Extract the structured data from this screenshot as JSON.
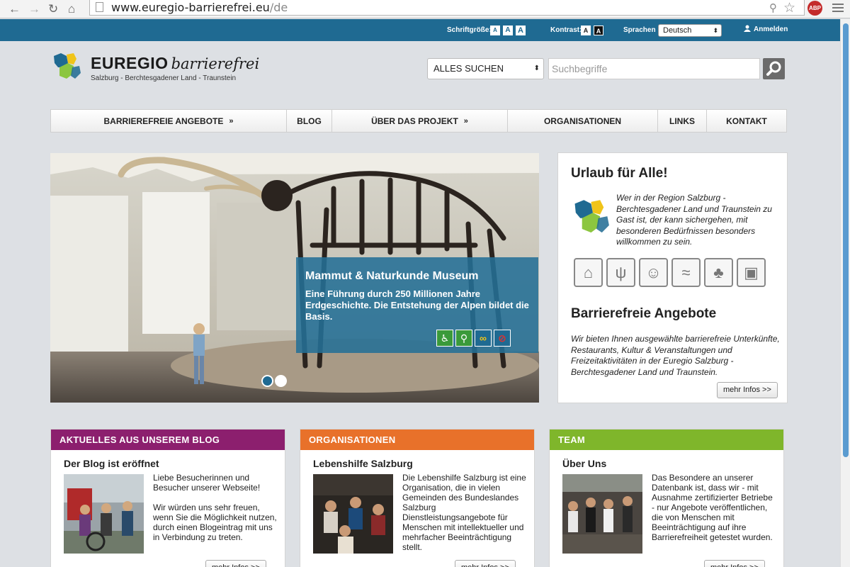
{
  "browser": {
    "url_host": "www.euregio-barrierefrei.eu",
    "url_path": "/de",
    "adblock_label": "ABP"
  },
  "topbar": {
    "font_size_label": "Schriftgröße:",
    "font_size_buttons": [
      "A",
      "A",
      "A"
    ],
    "contrast_label": "Kontrast:",
    "contrast_buttons": [
      "A",
      "A"
    ],
    "language_label": "Sprachen",
    "language_value": "Deutsch",
    "login_label": "Anmelden"
  },
  "logo": {
    "title_bold": "EUREGIO",
    "title_italic": "barrierefrei",
    "subtitle": "Salzburg - Berchtesgadener Land - Traunstein"
  },
  "search": {
    "category_value": "ALLES SUCHEN",
    "placeholder": "Suchbegriffe"
  },
  "nav": {
    "items": [
      {
        "label": "BARRIEREFREIE ANGEBOTE",
        "has_submenu": true
      },
      {
        "label": "BLOG",
        "has_submenu": false
      },
      {
        "label": "ÜBER DAS PROJEKT",
        "has_submenu": true
      },
      {
        "label": "ORGANISATIONEN",
        "has_submenu": false
      },
      {
        "label": "LINKS",
        "has_submenu": false
      },
      {
        "label": "KONTAKT",
        "has_submenu": false
      }
    ],
    "submenu_marker": "»"
  },
  "hero": {
    "title": "Mammut & Naturkunde Museum",
    "description": "Eine Führung durch 250 Millionen Jahre Erdgeschichte. Die Entstehung der Alpen bildet die Basis.",
    "accessibility_icons": [
      "wheelchair-icon",
      "walking-aid-icon",
      "glasses-icon",
      "hearing-impaired-icon"
    ],
    "slides_total": 2,
    "active_slide": 1
  },
  "sidebox": {
    "heading1": "Urlaub für Alle!",
    "intro": "Wer in der Region Salzburg - Berchtesgadener Land und Traunstein zu Gast ist, der kann sichergehen, mit besonderen Bedürfnissen besonders willkommen zu sein.",
    "category_icons": [
      "house-icon",
      "fork-knife-icon",
      "theater-mask-icon",
      "swimming-icon",
      "tree-icon",
      "bus-icon"
    ],
    "heading2": "Barrierefreie Angebote",
    "offers_text": "Wir bieten Ihnen ausgewählte barrierefreie Unterkünfte, Restaurants, Kultur & Veranstaltungen und Freizeitaktivitäten in der Euregio Salzburg - Berchtesgadener Land und Traunstein.",
    "more_label": "mehr Infos >>"
  },
  "boxes": [
    {
      "header": "AKTUELLES AUS UNSEREM BLOG",
      "color": "#8c1f6e",
      "title": "Der Blog ist eröffnet",
      "text": "Liebe Besucherinnen und Besucher unserer Webseite!\n\nWir würden uns sehr freuen, wenn Sie die Möglichkeit nutzen, durch einen Blogeintrag mit uns in Verbindung zu treten.",
      "more_label": "mehr Infos >>"
    },
    {
      "header": "ORGANISATIONEN",
      "color": "#e8712a",
      "title": "Lebenshilfe Salzburg",
      "text": "Die Lebenshilfe Salzburg ist eine Organisation, die in vielen Gemeinden des Bundeslandes Salzburg Dienstleistungsangebote für Menschen mit intellektueller und mehrfacher Beeinträchtigung stellt.",
      "more_label": "mehr Infos >>"
    },
    {
      "header": "TEAM",
      "color": "#7fb62b",
      "title": "Über Uns",
      "text": "Das Besondere an unserer Datenbank ist, dass wir - mit Ausnahme zertifizierter Betriebe  - nur Angebote veröffentlichen, die von Menschen mit Beeinträchtigung auf ihre Barrierefreiheit getestet wurden.",
      "more_label": "mehr Infos >>"
    }
  ]
}
